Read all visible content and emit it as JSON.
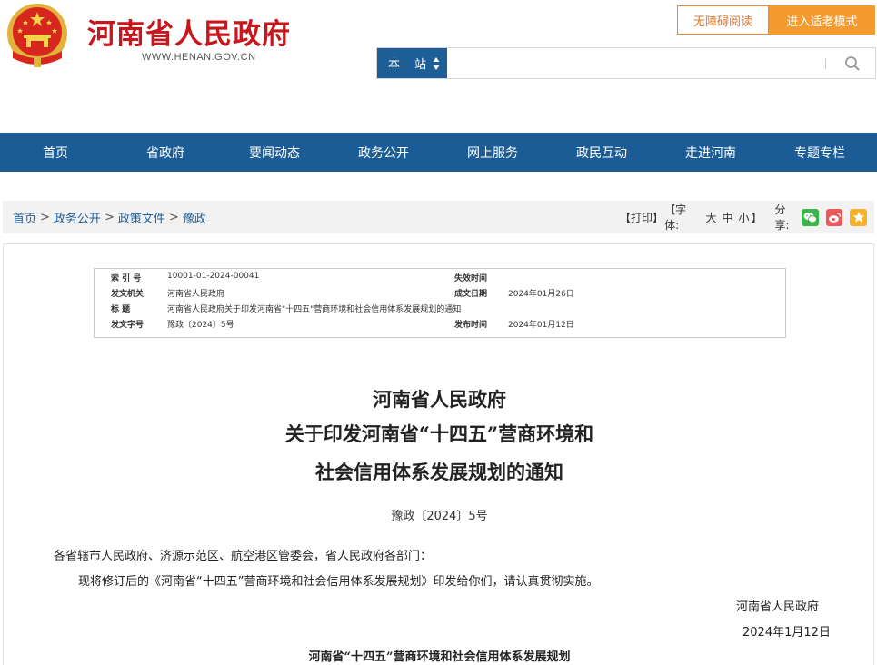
{
  "header": {
    "site_title": "河南省人民政府",
    "site_url": "WWW.HENAN.GOV.CN",
    "accessible_label": "无障碍阅读",
    "elder_mode_label": "进入适老模式",
    "search_scope": "本 站",
    "search_placeholder": ""
  },
  "nav": {
    "items": [
      "首页",
      "省政府",
      "要闻动态",
      "政务公开",
      "网上服务",
      "政民互动",
      "走进河南",
      "专题专栏"
    ]
  },
  "breadcrumb": {
    "items": [
      "首页",
      "政务公开",
      "政策文件",
      "豫政"
    ],
    "separator": ">"
  },
  "tools": {
    "print": "【打印】",
    "font_label": "【字体:",
    "font_large": "大",
    "font_medium": "中",
    "font_small": "小",
    "font_close": "】",
    "share_label": "分享:"
  },
  "meta": {
    "index_label": "索 引 号",
    "index_value": "10001-01-2024-00041",
    "expire_label": "失效时间",
    "expire_value": "",
    "issuer_label": "发文机关",
    "issuer_value": "河南省人民政府",
    "written_label": "成文日期",
    "written_value": "2024年01月26日",
    "title_label": "标 题",
    "title_value": "河南省人民政府关于印发河南省\"十四五\"营商环境和社会信用体系发展规划的通知",
    "number_label": "发文字号",
    "number_value": "豫政〔2024〕5号",
    "publish_label": "发布时间",
    "publish_value": "2024年01月12日"
  },
  "article": {
    "title_line1": "河南省人民政府",
    "title_line2": "关于印发河南省“十四五”营商环境和",
    "title_line3": "社会信用体系发展规划的通知",
    "doc_number": "豫政〔2024〕5号",
    "salutation": "各省辖市人民政府、济源示范区、航空港区管委会，省人民政府各部门：",
    "body": "现将修订后的《河南省“十四五”营商环境和社会信用体系发展规划》印发给你们，请认真贯彻实施。",
    "signature": "河南省人民政府",
    "date": "2024年1月12日",
    "plan_title": "河南省“十四五”营商环境和社会信用体系发展规划"
  },
  "colors": {
    "brand_red": "#c8161d",
    "nav_blue": "#1c5c96",
    "accent_orange": "#f59a2c",
    "wechat_green": "#3bb44a",
    "weibo_red": "#e9595b",
    "favorite_yellow": "#f5b226"
  },
  "icons": [
    "national-emblem-icon",
    "sort-arrows-icon",
    "search-icon",
    "wechat-icon",
    "weibo-icon",
    "favorite-star-icon"
  ]
}
